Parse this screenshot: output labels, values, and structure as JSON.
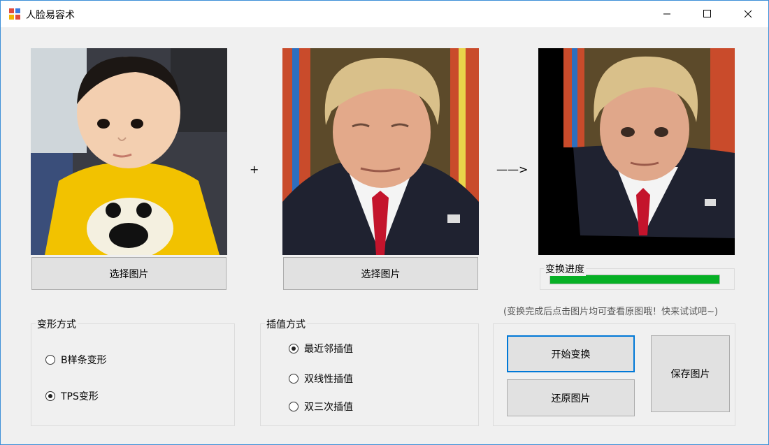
{
  "window": {
    "title": "人脸易容术"
  },
  "source_panel": {
    "select_label": "选择图片"
  },
  "target_panel": {
    "select_label": "选择图片"
  },
  "operators": {
    "plus": "+",
    "arrow": "——>"
  },
  "progress": {
    "label": "变换进度",
    "value": 1.0,
    "color": "#06b025"
  },
  "hint": "(变换完成后点击图片均可查看原图哦！快来试试吧~)",
  "deform": {
    "label": "变形方式",
    "options": [
      {
        "label": "B样条变形",
        "checked": false
      },
      {
        "label": "TPS变形",
        "checked": true
      }
    ]
  },
  "interp": {
    "label": "插值方式",
    "options": [
      {
        "label": "最近邻插值",
        "checked": true
      },
      {
        "label": "双线性插值",
        "checked": false
      },
      {
        "label": "双三次插值",
        "checked": false
      }
    ]
  },
  "actions": {
    "start": "开始变换",
    "restore": "还原图片",
    "save": "保存图片"
  },
  "colors": {
    "accent": "#0078d7",
    "progress": "#06b025"
  }
}
